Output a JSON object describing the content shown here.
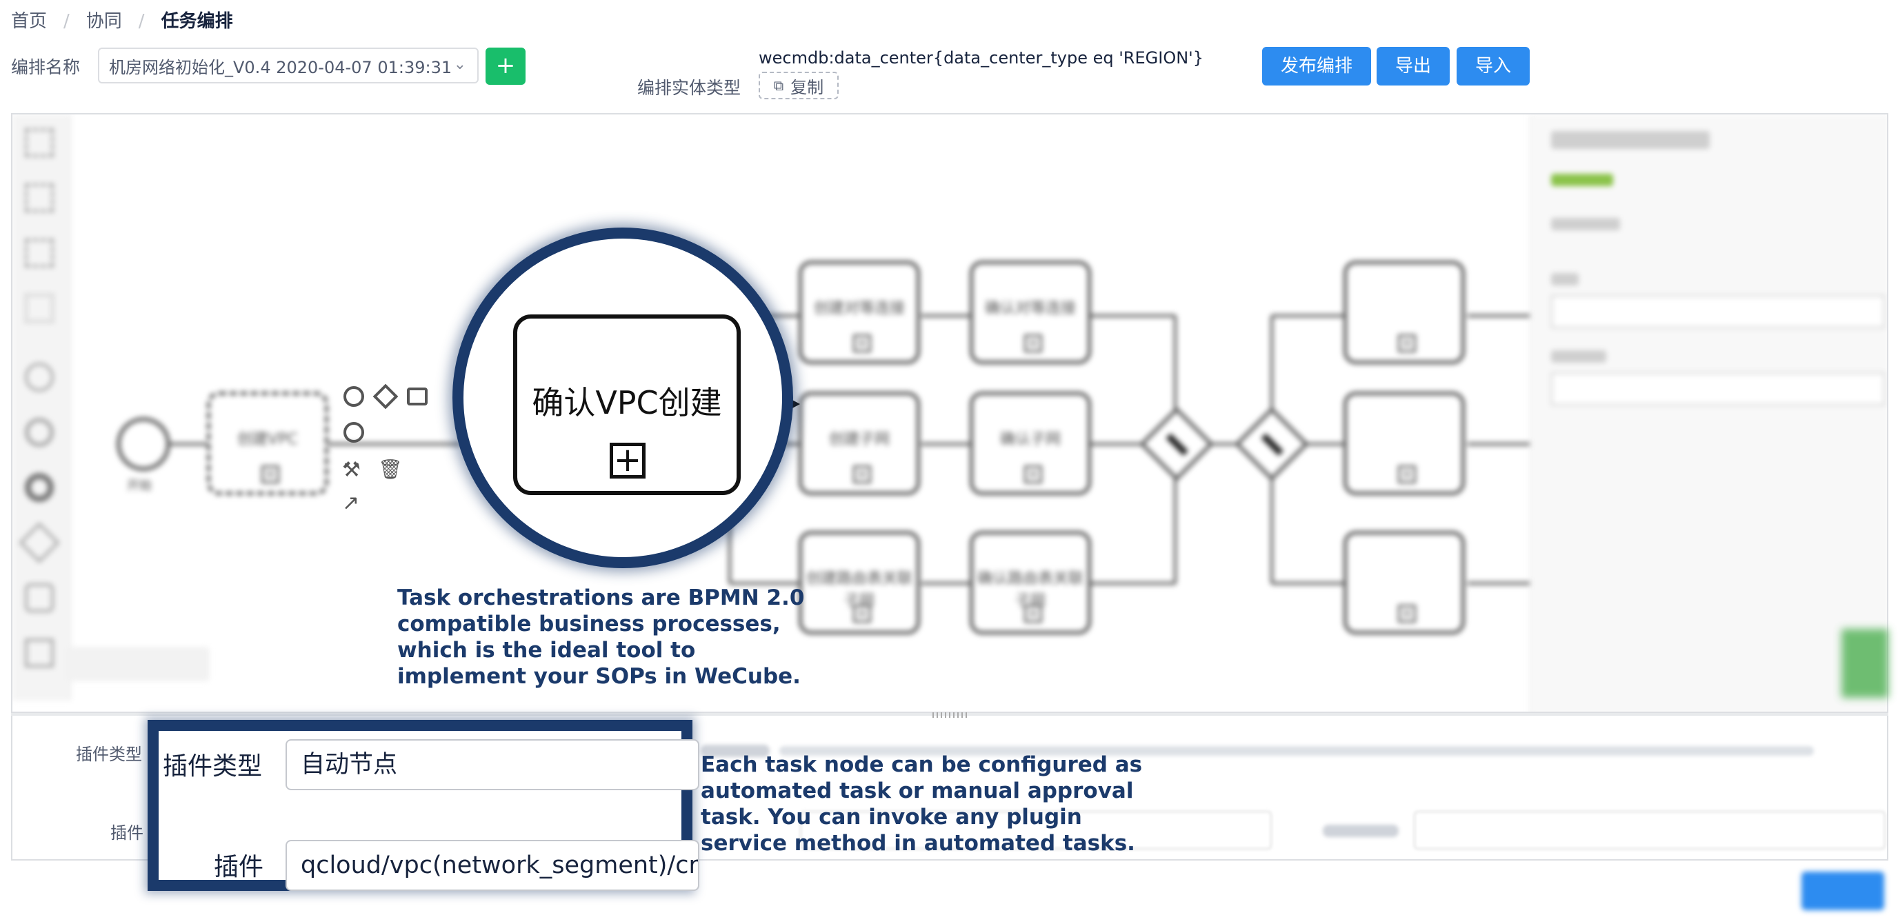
{
  "breadcrumb": {
    "home": "首页",
    "collab": "协同",
    "current": "任务编排",
    "separator": "/"
  },
  "header": {
    "name_label": "编排名称",
    "selected_orchestration": "机房网络初始化_V0.4 2020-04-07 01:39:31",
    "add_button": "+",
    "entity_type_label": "编排实体类型",
    "entity_query": "wecmdb:data_center{data_center_type eq 'REGION'}",
    "copy_label": "复制",
    "buttons": {
      "publish": "发布编排",
      "export": "导出",
      "import": "导入"
    }
  },
  "diagram": {
    "start_label": "开始",
    "tasks": [
      "创建VPC",
      "创建对等连接",
      "确认对等连接",
      "创建子网",
      "确认子网",
      "创建路由表关联子网",
      "确认路由表关联子网"
    ],
    "magnified_task": "确认VPC创建",
    "caption": [
      "Task orchestrations are BPMN 2.0",
      "compatible business processes,",
      "which is the ideal tool to",
      "implement your SOPs in WeCube."
    ]
  },
  "bottom": {
    "plugin_type_label": "插件类型",
    "plugin_label": "插件",
    "zoom_plugin_type_label": "插件类型",
    "zoom_plugin_type_value": "自动节点",
    "zoom_plugin_label": "插件",
    "zoom_plugin_value": "qcloud/vpc(network_segment)/create",
    "caption": [
      "Each task node can be configured as",
      "automated task or manual approval",
      "task. You can invoke any plugin",
      "service method in automated tasks."
    ]
  },
  "colors": {
    "primary": "#2d8cf0",
    "success": "#19be6b",
    "highlight": "#1b3a6b"
  }
}
